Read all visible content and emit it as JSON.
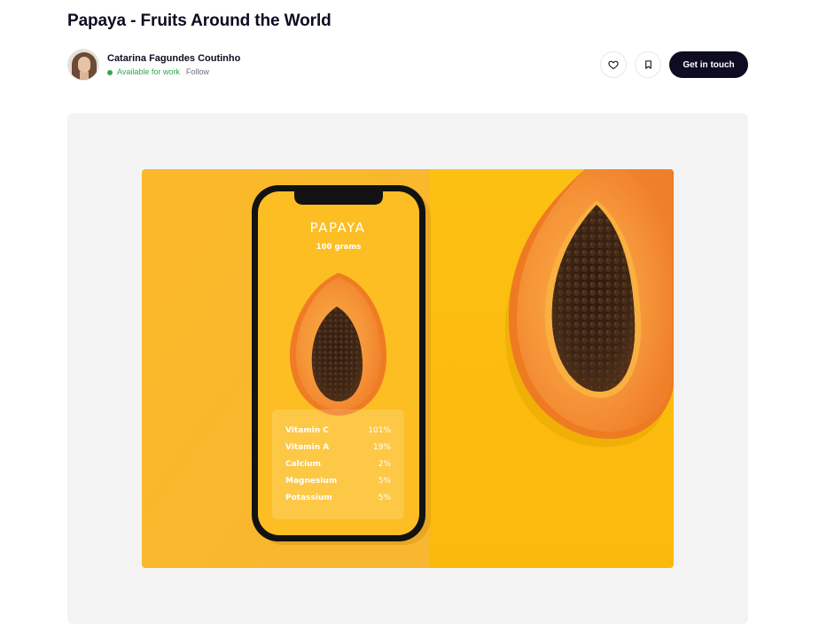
{
  "shot": {
    "title": "Papaya - Fruits Around the World"
  },
  "author": {
    "name": "Catarina Fagundes Coutinho",
    "status": "Available for work",
    "follow_label": "Follow"
  },
  "actions": {
    "like_icon": "heart-icon",
    "save_icon": "bookmark-icon",
    "cta_label": "Get in touch"
  },
  "colors": {
    "accent_dark": "#0d0c22",
    "status_green": "#2fa84f",
    "frame_bg": "#f3f3f4",
    "papaya_yellow": "#fbbd08"
  },
  "phone_screen": {
    "fruit": "PAPAYA",
    "portion": "100 grams",
    "nutrients": [
      {
        "name": "Vitamin C",
        "value": "101%"
      },
      {
        "name": "Vitamin A",
        "value": "19%"
      },
      {
        "name": "Calcium",
        "value": "2%"
      },
      {
        "name": "Magnesium",
        "value": "5%"
      },
      {
        "name": "Potassium",
        "value": "5%"
      }
    ]
  }
}
